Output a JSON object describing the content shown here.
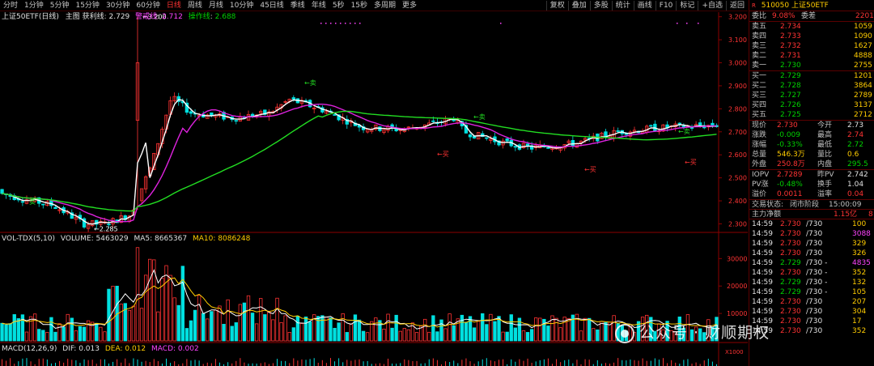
{
  "toolbar": {
    "periods": [
      "分时",
      "1分钟",
      "5分钟",
      "15分钟",
      "30分钟",
      "60分钟",
      "日线",
      "周线",
      "月线",
      "10分钟",
      "45日线",
      "季线",
      "年线",
      "5秒",
      "15秒",
      "多周期",
      "更多"
    ],
    "active_period": "日线",
    "tools": [
      "复权",
      "叠加",
      "多股",
      "统计",
      "画线",
      "F10",
      "标记",
      "+自选",
      "返回"
    ]
  },
  "main_chart": {
    "title": "上证50ETF(日线)",
    "indicator_name": "主图 获利线",
    "line1_label": "获利线",
    "line1_value": "2.729",
    "line2_label": "警戒线",
    "line2_value": "2.712",
    "line3_label": "操作线",
    "line3_value": "2.688",
    "high_annotation": "3.200",
    "low_annotation": "2.285",
    "arrow_sell": "←卖",
    "arrow_buy": "←买",
    "buy_plain": "卖",
    "price_ticks": [
      "3.200",
      "3.100",
      "3.000",
      "2.900",
      "2.800",
      "2.700",
      "2.600",
      "2.500",
      "2.400",
      "2.300"
    ],
    "colors": {
      "up": "#ff3333",
      "down": "#00e0e0",
      "line1": "#ffffff",
      "line2": "#dd22dd",
      "line3": "#22dd22"
    }
  },
  "volume_chart": {
    "title": "VOL-TDX(5,10)",
    "volume_label": "VOLUME:",
    "volume_value": "5463029",
    "ma5_label": "MA5:",
    "ma5_value": "8665367",
    "ma10_label": "MA10:",
    "ma10_value": "8086248",
    "ticks": [
      "30000",
      "20000",
      "10000"
    ],
    "unit": "X1000"
  },
  "macd_chart": {
    "title": "MACD(12,26,9)",
    "dif_label": "DIF:",
    "dif_value": "0.013",
    "dea_label": "DEA:",
    "dea_value": "0.012",
    "macd_label": "MACD:",
    "macd_value": "0.002"
  },
  "quote_panel": {
    "code": "510050",
    "name": "上证50ETF",
    "badge": "R",
    "wei_bi_label": "委比",
    "wei_bi_value": "9.08%",
    "wei_cha_label": "委差",
    "wei_cha_value": "2201",
    "asks": [
      {
        "label": "卖五",
        "price": "2.734",
        "vol": "1059"
      },
      {
        "label": "卖四",
        "price": "2.733",
        "vol": "1090"
      },
      {
        "label": "卖三",
        "price": "2.732",
        "vol": "1627"
      },
      {
        "label": "卖二",
        "price": "2.731",
        "vol": "4888"
      },
      {
        "label": "卖一",
        "price": "2.730",
        "vol": "2755"
      }
    ],
    "bids": [
      {
        "label": "买一",
        "price": "2.729",
        "vol": "1201"
      },
      {
        "label": "买二",
        "price": "2.728",
        "vol": "3864"
      },
      {
        "label": "买三",
        "price": "2.727",
        "vol": "2789"
      },
      {
        "label": "买四",
        "price": "2.726",
        "vol": "3137"
      },
      {
        "label": "买五",
        "price": "2.725",
        "vol": "2712"
      }
    ],
    "stats": [
      {
        "l1": "现价",
        "v1": "2.730",
        "c1": "red",
        "l2": "今开",
        "v2": "2.73",
        "c2": "wht"
      },
      {
        "l1": "涨跌",
        "v1": "-0.009",
        "c1": "grn",
        "l2": "最高",
        "v2": "2.74",
        "c2": "red"
      },
      {
        "l1": "涨幅",
        "v1": "-0.33%",
        "c1": "grn",
        "l2": "最低",
        "v2": "2.72",
        "c2": "grn"
      },
      {
        "l1": "总量",
        "v1": "546.3万",
        "c1": "yel",
        "l2": "量比",
        "v2": "0.6",
        "c2": "yel"
      },
      {
        "l1": "外盘",
        "v1": "250.8万",
        "c1": "red",
        "l2": "内盘",
        "v2": "295.5",
        "c2": "grn"
      }
    ],
    "stats2": [
      {
        "l1": "IOPV",
        "v1": "2.7289",
        "c1": "red",
        "l2": "昨PV",
        "v2": "2.742",
        "c2": "wht"
      },
      {
        "l1": "PV涨",
        "v1": "-0.48%",
        "c1": "grn",
        "l2": "换手",
        "v2": "1.04",
        "c2": "wht"
      },
      {
        "l1": "溢价",
        "v1": "0.0011",
        "c1": "red",
        "l2": "溢率",
        "v2": "0.04",
        "c2": "red"
      }
    ],
    "trade_status_label": "交易状态:",
    "trade_status_value": "闭市阶段",
    "trade_time": "15:00:09",
    "net_flow_label": "主力净额",
    "net_flow_value": "1.15亿",
    "net_flow_tail": "8",
    "ticks": [
      {
        "t": "14:59",
        "p": "2.730",
        "s": "/730",
        "v": "100",
        "c": "yel"
      },
      {
        "t": "14:59",
        "p": "2.730",
        "s": "/730",
        "v": "3088",
        "c": "mag"
      },
      {
        "t": "14:59",
        "p": "2.730",
        "s": "/730",
        "v": "329",
        "c": "yel"
      },
      {
        "t": "14:59",
        "p": "2.730",
        "s": "/730",
        "v": "326",
        "c": "yel"
      },
      {
        "t": "14:59",
        "p": "2.729",
        "s": "/730 -",
        "v": "4835",
        "c": "mag"
      },
      {
        "t": "14:59",
        "p": "2.730",
        "s": "/730 -",
        "v": "352",
        "c": "yel"
      },
      {
        "t": "14:59",
        "p": "2.729",
        "s": "/730 -",
        "v": "132",
        "c": "yel"
      },
      {
        "t": "14:59",
        "p": "2.729",
        "s": "/730 -",
        "v": "105",
        "c": "yel"
      },
      {
        "t": "14:59",
        "p": "2.730",
        "s": "/730",
        "v": "207",
        "c": "yel"
      },
      {
        "t": "14:59",
        "p": "2.730",
        "s": "/730",
        "v": "304",
        "c": "yel"
      },
      {
        "t": "14:59",
        "p": "2.730",
        "s": "/730",
        "v": "17",
        "c": "yel"
      },
      {
        "t": "14:59",
        "p": "2.730",
        "s": "/730",
        "v": "352",
        "c": "yel"
      }
    ]
  },
  "watermark": "公众号 · 财顺期权"
}
